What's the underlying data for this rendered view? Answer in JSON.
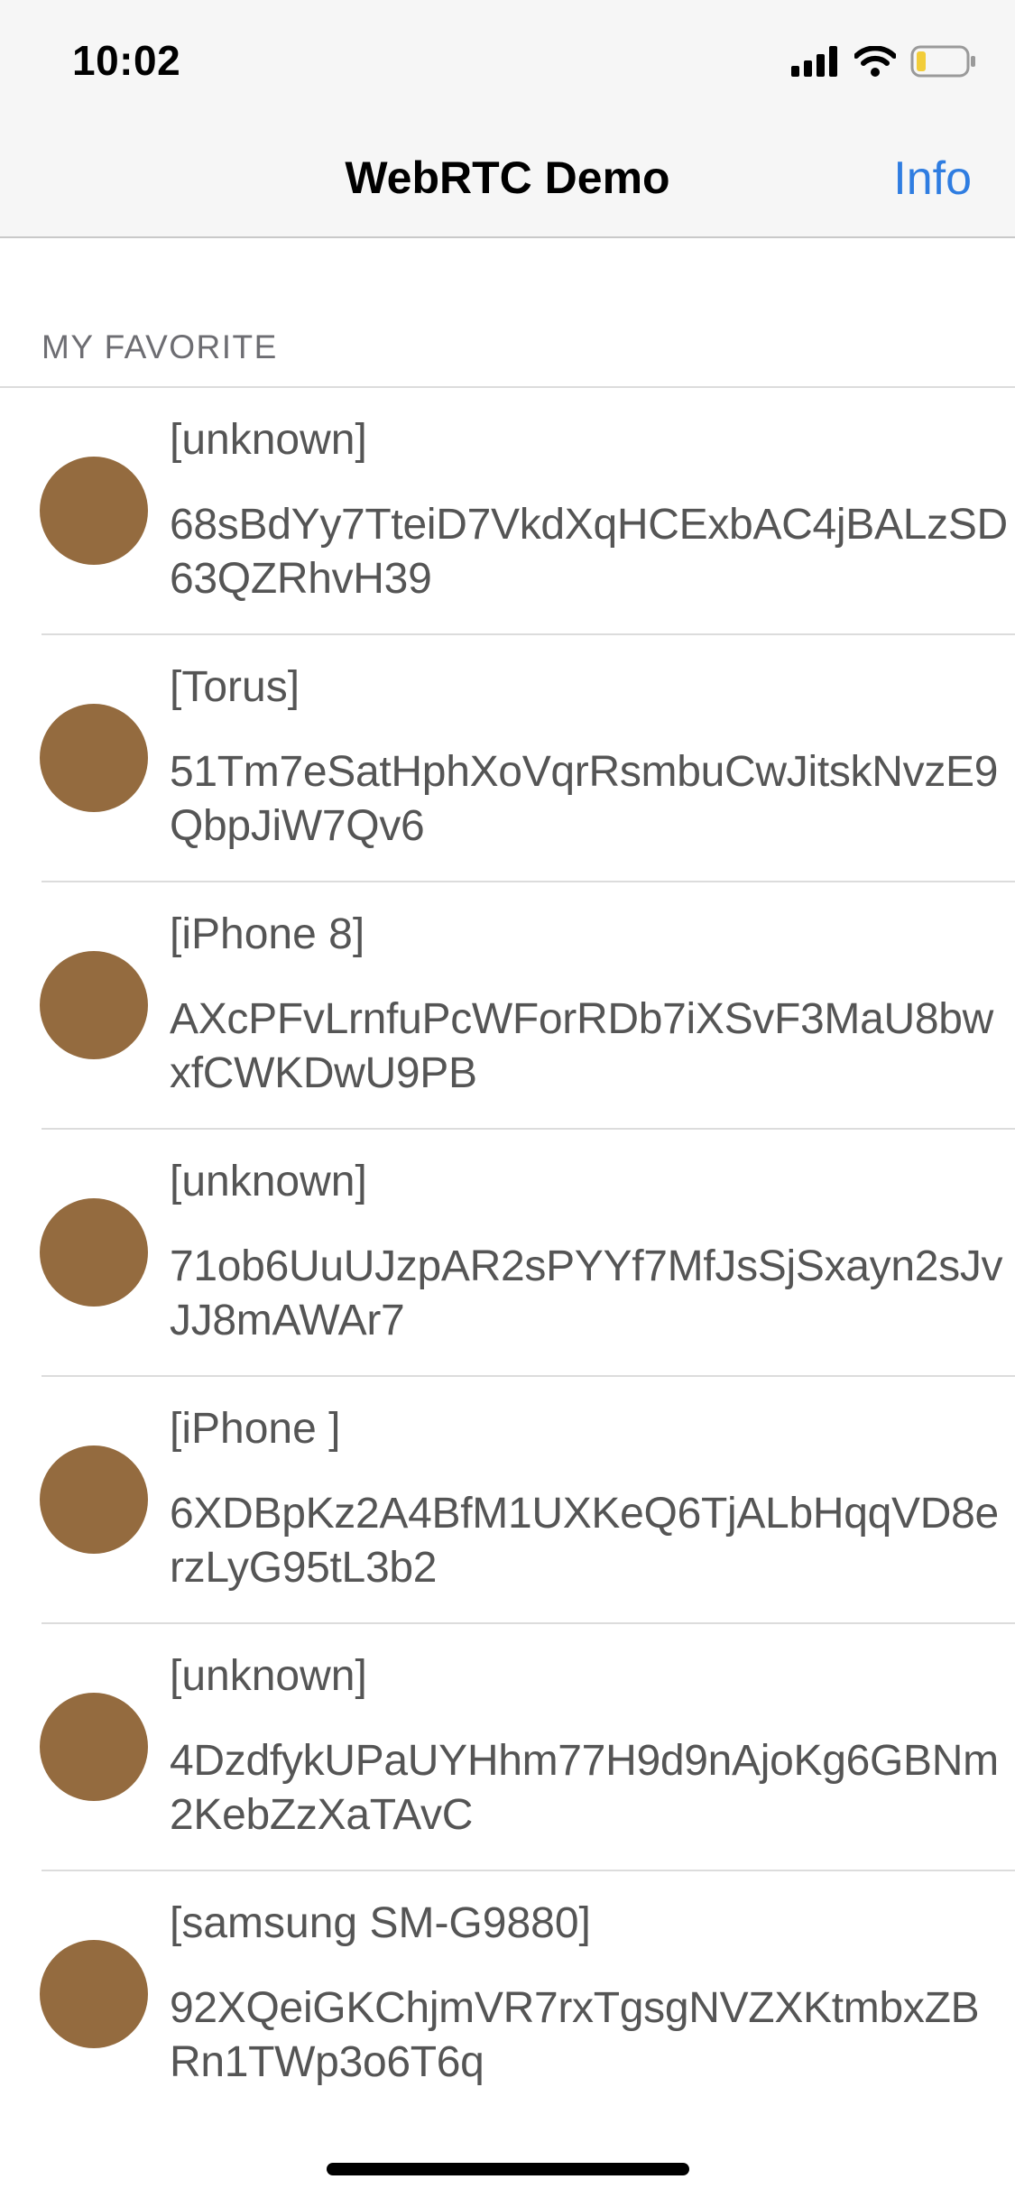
{
  "status_bar": {
    "time": "10:02",
    "signal_icon": "cellular-signal-icon",
    "wifi_icon": "wifi-icon",
    "battery_icon": "battery-low-icon"
  },
  "nav": {
    "title": "WebRTC Demo",
    "action_label": "Info"
  },
  "section": {
    "header": "MY FAVORITE"
  },
  "devices": [
    {
      "name": "[unknown]",
      "id": "68sBdYy7TteiD7VkdXqHCExbAC4jBALzSD63QZRhvH39"
    },
    {
      "name": "[Torus]",
      "id": "51Tm7eSatHphXoVqrRsmbuCwJitskNvzE9QbpJiW7Qv6"
    },
    {
      "name": "[iPhone 8]",
      "id": "AXcPFvLrnfuPcWForRDb7iXSvF3MaU8bwxfCWKDwU9PB"
    },
    {
      "name": "[unknown]",
      "id": "71ob6UuUJzpAR2sPYYf7MfJsSjSxayn2sJvJJ8mAWAr7"
    },
    {
      "name": "[iPhone ]",
      "id": "6XDBpKz2A4BfM1UXKeQ6TjALbHqqVD8erzLyG95tL3b2"
    },
    {
      "name": "[unknown]",
      "id": "4DzdfykUPaUYHhm77H9d9nAjoKg6GBNm2KebZzXaTAvC"
    },
    {
      "name": "[samsung SM-G9880]",
      "id": "92XQeiGKChjmVR7rxTgsgNVZXKtmbxZBRn1TWp3o6T6q"
    }
  ],
  "colors": {
    "accent": "#2f7de1",
    "avatar": "#946b3f"
  }
}
